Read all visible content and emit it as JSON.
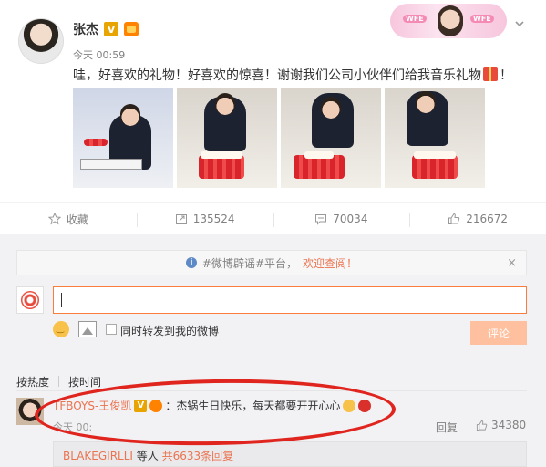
{
  "post": {
    "author": "张杰",
    "verified": "V",
    "time": "今天 00:59",
    "text_before": "哇，好喜欢的礼物！好喜欢的惊喜！谢谢我们公司小伙伴们给我音乐礼物",
    "text_after": "！"
  },
  "banner": {
    "left_tag": "WFE",
    "right_tag": "WFE"
  },
  "actions": {
    "favorite": "收藏",
    "repost": "135524",
    "comment": "70034",
    "like": "216672"
  },
  "notice": {
    "text": "#微博辟谣#平台，",
    "link": "欢迎查阅！",
    "close": "×"
  },
  "composer": {
    "checkbox_label": "同时转发到我的微博",
    "submit": "评论"
  },
  "sort": {
    "by_hot": "按热度",
    "by_time": "按时间"
  },
  "comment": {
    "user": "TFBOYS-王俊凯",
    "verified": "V",
    "text": "：杰锅生日快乐，每天都要开开心心",
    "time": "今天 00:",
    "reply": "回复",
    "likes": "34380"
  },
  "thread": {
    "user": "BLAKEGIRLLI",
    "mid": " 等人 ",
    "count": "共6633条回复"
  },
  "colors": {
    "accent": "#eb7350",
    "highlight_ring": "#e0241e",
    "verified": "#e8a400"
  }
}
